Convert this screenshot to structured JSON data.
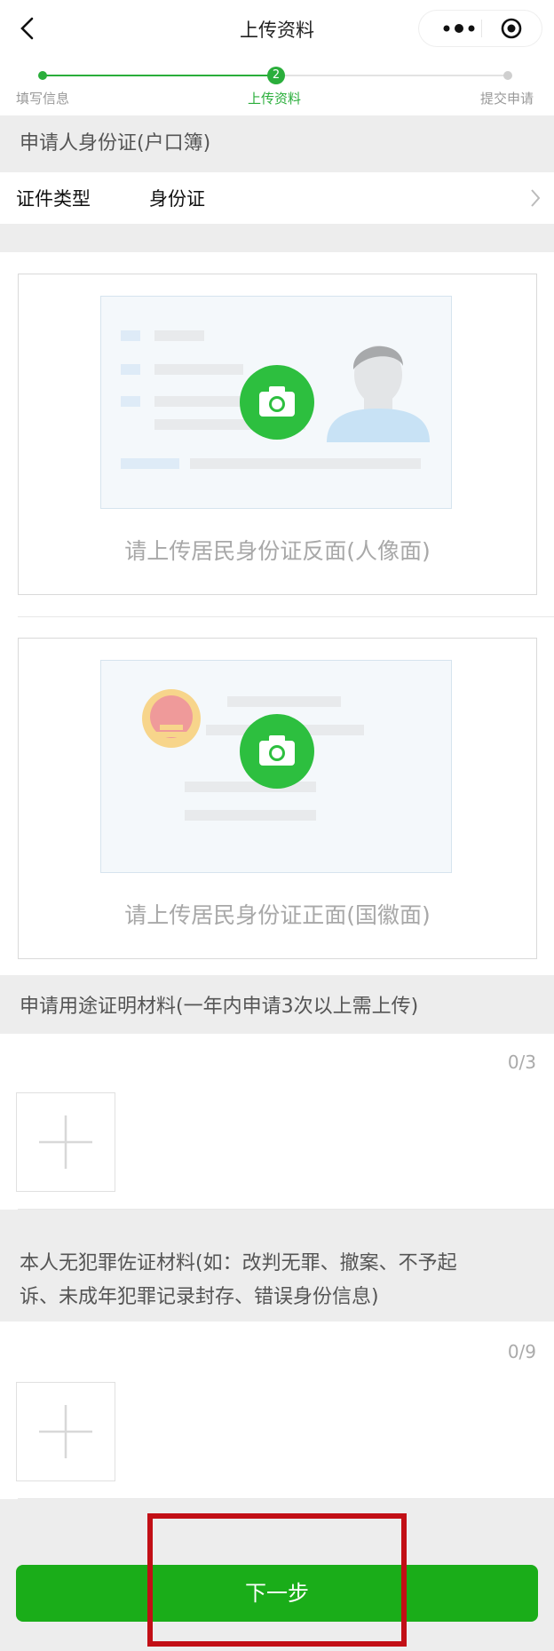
{
  "header": {
    "title": "上传资料",
    "back_icon": "chevron-left-icon",
    "more_icon": "more-dots-icon",
    "close_icon": "target-circle-icon"
  },
  "steps": [
    {
      "label": "填写信息",
      "state": "done"
    },
    {
      "label": "上传资料",
      "state": "current",
      "number": "2"
    },
    {
      "label": "提交申请",
      "state": "pending"
    }
  ],
  "applicant_section": {
    "title": "申请人身份证(户口簿)",
    "doc_type_label": "证件类型",
    "doc_type_value": "身份证"
  },
  "cards": {
    "portrait_caption": "请上传居民身份证反面(人像面)",
    "emblem_caption": "请上传居民身份证正面(国徽面)"
  },
  "purpose_section": {
    "title": "申请用途证明材料(一年内申请3次以上需上传)",
    "counter": "0/3"
  },
  "evidence_section": {
    "title_line1": "本人无犯罪佐证材料(如：改判无罪、撤案、不予起",
    "title_line2": "诉、未成年犯罪记录封存、错误身份信息)",
    "counter": "0/9"
  },
  "footer": {
    "next_label": "下一步"
  },
  "colors": {
    "primary_green": "#1aad19",
    "camera_green": "#2dbf3f",
    "highlight_red": "#c20f16"
  }
}
